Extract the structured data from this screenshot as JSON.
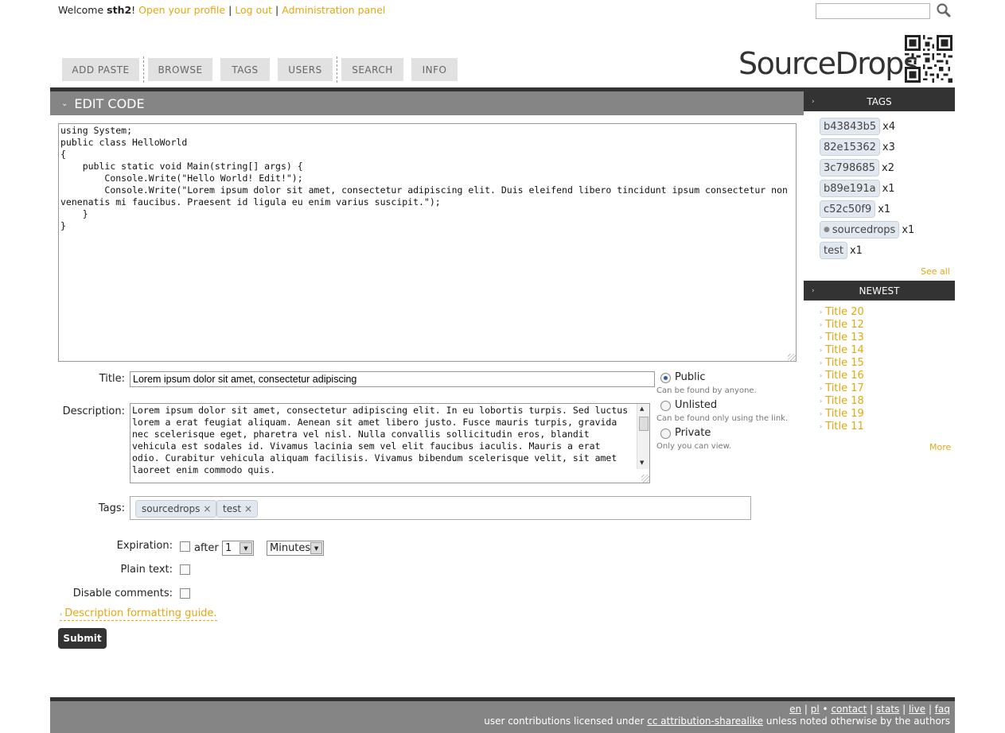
{
  "topbar": {
    "welcome": "Welcome ",
    "username": "sth2",
    "bang": "!",
    "profile_link": "Open your profile",
    "sep": " | ",
    "logout_link": "Log out",
    "admin_link": "Administration panel",
    "search_placeholder": ""
  },
  "logo": {
    "text": "SourceDrops"
  },
  "nav": {
    "add_paste": "ADD PASTE",
    "browse": "BROWSE",
    "tags": "TAGS",
    "users": "USERS",
    "search": "SEARCH",
    "info": "INFO"
  },
  "edit": {
    "header": "EDIT CODE",
    "code": "using System;\npublic class HelloWorld\n{\n    public static void Main(string[] args) {\n        Console.Write(\"Hello World! Edit!\");\n        Console.Write(\"Lorem ipsum dolor sit amet, consectetur adipiscing elit. Duis eleifend libero tincidunt ipsum consectetur non venenatis mi faucibus. Praesent id ligula eu enim varius suscipit.\");\n    }\n}"
  },
  "form": {
    "title_label": "Title:",
    "title_value": "Lorem ipsum dolor sit amet, consectetur adipiscing",
    "description_label": "Description:",
    "description_value": "Lorem ipsum dolor sit amet, consectetur adipiscing elit. In eu lobortis turpis. Sed luctus lorem a erat feugiat aliquam. Aenean sit amet libero justo. Fusce mauris turpis, gravida nec scelerisque eget, pharetra vel nisl. Nulla convallis sollicitudin eros, blandit vehicula est sodales id. Vivamus lacinia sem vel elit faucibus iaculis. Mauris a erat odio. Curabitur vehicula aliquam facilisis. Vivamus bibendum scelerisque velit, sit amet laoreet enim commodo quis.",
    "visibility": {
      "selected": "public",
      "public_label": "Public",
      "public_desc": "Can be found by anyone.",
      "unlisted_label": "Unlisted",
      "unlisted_desc": "Can be found only using the link.",
      "private_label": "Private",
      "private_desc": "Only you can view."
    },
    "tags_label": "Tags:",
    "tags": [
      "sourcedrops",
      "test"
    ],
    "tag_remove": "×",
    "expiration_label": "Expiration:",
    "after_label": "after",
    "expiration_amount": "1",
    "expiration_unit": "Minutes",
    "plain_text_label": "Plain text:",
    "disable_comments_label": "Disable comments:",
    "guide_link": "Description formatting guide.",
    "submit": "Submit"
  },
  "sidebar": {
    "tags_title": "TAGS",
    "tags": [
      {
        "name": "b43843b5",
        "count": "x4"
      },
      {
        "name": "82e15362",
        "count": "x3"
      },
      {
        "name": "3c798685",
        "count": "x2"
      },
      {
        "name": "b89e191a",
        "count": "x1"
      },
      {
        "name": "c52c50f9",
        "count": "x1"
      },
      {
        "name": "sourcedrops",
        "count": "x1"
      },
      {
        "name": "test",
        "count": "x1"
      }
    ],
    "see_all": "See all",
    "newest_title": "NEWEST",
    "newest": [
      "Title 20",
      "Title 12",
      "Title 13",
      "Title 14",
      "Title 15",
      "Title 16",
      "Title 17",
      "Title 18",
      "Title 19",
      "Title 11"
    ],
    "more": "More"
  },
  "footer": {
    "lang_en": "en",
    "lang_pl": "pl",
    "bullet": " • ",
    "contact": "contact",
    "stats": "stats",
    "live": "live",
    "faq": "faq",
    "license_prefix": "user contributions licensed under ",
    "license_link": "cc attribution-sharealike",
    "license_suffix": " unless noted otherwise by the authors"
  },
  "colors": {
    "accent": "#e5a70f",
    "dark": "#333333",
    "header_gray": "#858585",
    "nav_gray": "#e1e1e1"
  }
}
